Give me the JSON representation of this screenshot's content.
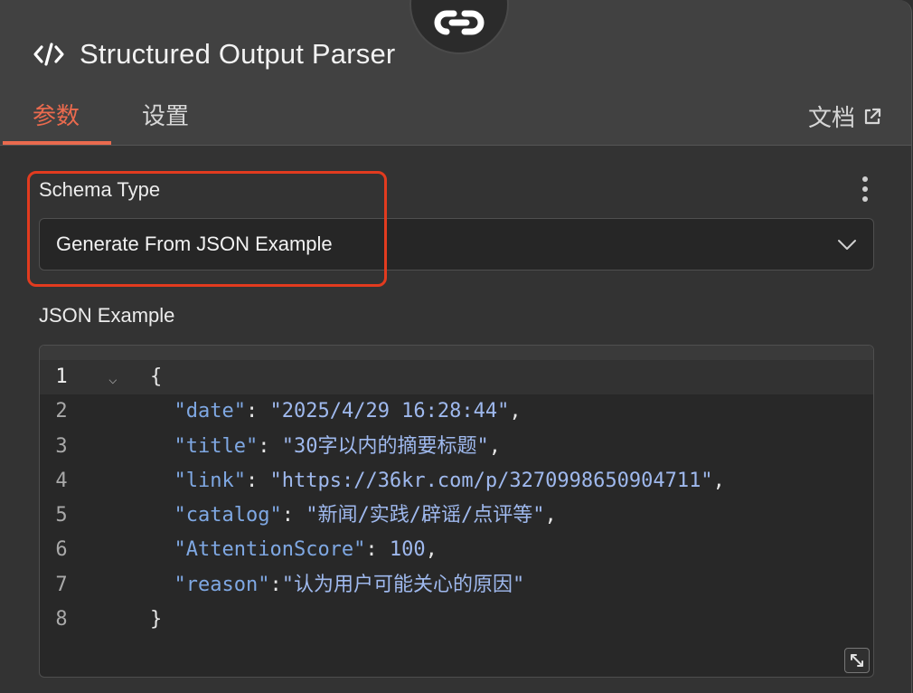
{
  "node": {
    "title": "Structured Output Parser",
    "icon": "code-icon",
    "connector_icon": "link-icon"
  },
  "tabs": [
    {
      "label": "参数",
      "active": true
    },
    {
      "label": "设置",
      "active": false
    }
  ],
  "docs_link": {
    "label": "文档",
    "icon": "external-link-icon"
  },
  "schema_type": {
    "label": "Schema Type",
    "value": "Generate From JSON Example",
    "icon": "chevron-down-icon"
  },
  "json_example": {
    "label": "JSON Example",
    "line_numbers": [
      "1",
      "2",
      "3",
      "4",
      "5",
      "6",
      "7",
      "8"
    ],
    "lines": {
      "l1": {
        "brace": "{"
      },
      "l2": {
        "key": "\"date\"",
        "sep": ": ",
        "value": "\"2025/4/29 16:28:44\"",
        "end": ","
      },
      "l3": {
        "key": "\"title\"",
        "sep": ": ",
        "value": "\"30字以内的摘要标题\"",
        "end": ","
      },
      "l4": {
        "key": "\"link\"",
        "sep": ": ",
        "value": "\"https://36kr.com/p/3270998650904711\"",
        "end": ","
      },
      "l5": {
        "key": "\"catalog\"",
        "sep": ": ",
        "value": "\"新闻/实践/辟谣/点评等\"",
        "end": ","
      },
      "l6": {
        "key": "\"AttentionScore\"",
        "sep": ": ",
        "value": "100",
        "end": ","
      },
      "l7": {
        "key": "\"reason\"",
        "sep": ":",
        "value": "\"认为用户可能关心的原因\"",
        "end": ""
      },
      "l8": {
        "brace": "}"
      }
    }
  },
  "colors": {
    "accent": "#ea6a4e",
    "highlight_border": "#e23b1f",
    "json_key": "#7fa8e3",
    "json_value": "#9fb9ee"
  }
}
